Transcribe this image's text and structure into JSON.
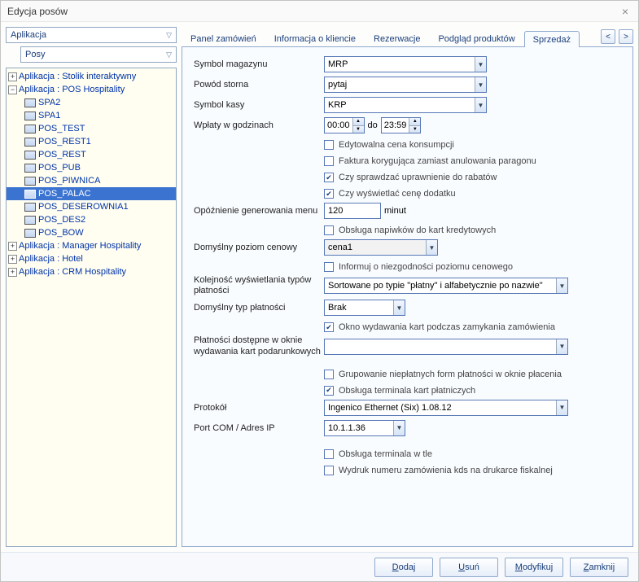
{
  "window": {
    "title": "Edycja posów"
  },
  "left": {
    "app_combo": "Aplikacja",
    "posy_combo": "Posy"
  },
  "tree": {
    "roots": [
      {
        "label": "Aplikacja : Stolik interaktywny",
        "expanded": false,
        "children": []
      },
      {
        "label": "Aplikacja : POS Hospitality",
        "expanded": true,
        "children": [
          {
            "label": "SPA2"
          },
          {
            "label": "SPA1"
          },
          {
            "label": "POS_TEST"
          },
          {
            "label": "POS_REST1"
          },
          {
            "label": "POS_REST"
          },
          {
            "label": "POS_PUB"
          },
          {
            "label": "POS_PIWNICA"
          },
          {
            "label": "POS_PALAC",
            "selected": true
          },
          {
            "label": "POS_DESEROWNIA1"
          },
          {
            "label": "POS_DES2"
          },
          {
            "label": "POS_BOW"
          }
        ]
      },
      {
        "label": "Aplikacja : Manager Hospitality",
        "expanded": false,
        "children": []
      },
      {
        "label": "Aplikacja : Hotel",
        "expanded": false,
        "children": []
      },
      {
        "label": "Aplikacja : CRM Hospitality",
        "expanded": false,
        "children": []
      }
    ]
  },
  "tabs": [
    "Panel zamówień",
    "Informacja o kliencie",
    "Rezerwacje",
    "Podgląd produktów",
    "Sprzedaż"
  ],
  "active_tab": 4,
  "form": {
    "symbol_mag_label": "Symbol magazynu",
    "symbol_mag_value": "MRP",
    "powod_storna_label": "Powód storna",
    "powod_storna_value": "pytaj",
    "symbol_kasy_label": "Symbol kasy",
    "symbol_kasy_value": "KRP",
    "wplaty_label": "Wpłaty w godzinach",
    "wplaty_from": "00:00",
    "wplaty_do_label": "do",
    "wplaty_to": "23:59",
    "cb_edytowalna": "Edytowalna cena konsumpcji",
    "cb_faktura": "Faktura korygująca zamiast anulowania paragonu",
    "cb_sprawdzac": "Czy sprawdzać uprawnienie do rabatów",
    "cb_wyswietlac": "Czy wyświetlać cenę dodatku",
    "opoznienie_label": "Opóźnienie generowania menu",
    "opoznienie_value": "120",
    "opoznienie_unit": "minut",
    "cb_obsluga_napiwkow": "Obsługa napiwków do kart kredytowych",
    "poziom_cenowy_label": "Domyślny poziom cenowy",
    "poziom_cenowy_value": "cena1",
    "cb_informuj": "Informuj o niezgodności poziomu cenowego",
    "kolejnosc_label1": "Kolejność wyświetlania typów",
    "kolejnosc_label2": "płatności",
    "kolejnosc_value": "Sortowane po typie \"płatny\" i alfabetycznie po nazwie\"",
    "typ_platnosci_label": "Domyślny typ płatności",
    "typ_platnosci_value": "Brak",
    "cb_okno_wydawania": "Okno wydawania kart podczas zamykania zamówienia",
    "platnosci_okno_label1": "Płatności dostępne w oknie",
    "platnosci_okno_label2": "wydawania kart podarunkowych",
    "platnosci_okno_value": "",
    "cb_grupowanie": "Grupowanie niepłatnych form płatności w oknie płacenia",
    "cb_obsluga_terminala": "Obsługa terminala kart płatniczych",
    "protokol_label": "Protokół",
    "protokol_value": "Ingenico Ethernet (Six) 1.08.12",
    "port_label": "Port COM / Adres IP",
    "port_value": "10.1.1.36",
    "cb_terminal_tle": "Obsługa terminala w tle",
    "cb_wydruk": "Wydruk numeru zamówienia kds na drukarce fiskalnej"
  },
  "footer": {
    "dodaj": "Dodaj",
    "usun": "Usuń",
    "modyfikuj": "Modyfikuj",
    "zamknij": "Zamknij"
  }
}
